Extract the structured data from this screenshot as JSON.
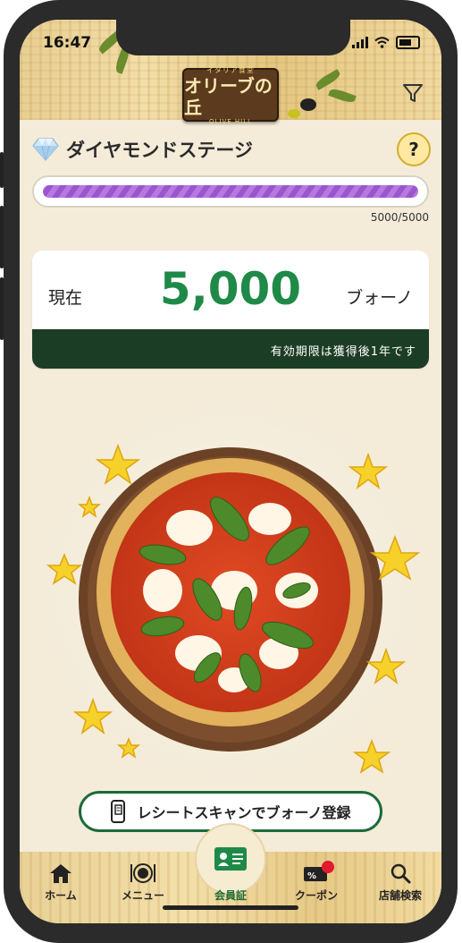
{
  "status": {
    "time": "16:47"
  },
  "logo": {
    "sub": "イタリア食堂",
    "main": "オリーブの丘",
    "en": "OLIVE HILL"
  },
  "stage": {
    "title": "ダイヤモンドステージ",
    "help": "?",
    "progress_text": "5000/5000",
    "progress_fraction": 1.0
  },
  "points": {
    "label": "現在",
    "value": "5,000",
    "unit": "ブォーノ",
    "expiry": "有効期限は獲得後1年です"
  },
  "scan_button": {
    "label": "レシートスキャンでブォーノ登録"
  },
  "nav": {
    "home": "ホーム",
    "menu": "メニュー",
    "member": "会員証",
    "coupon": "クーポン",
    "store": "店舗検索"
  },
  "colors": {
    "accent_green": "#1f8a48",
    "dark_green": "#1c3d25",
    "progress_purple": "#b679df",
    "badge_red": "#e3192f"
  },
  "icons": [
    "filter-icon",
    "diamond-icon",
    "help-icon",
    "receipt-phone-icon",
    "home-icon",
    "menu-plate-icon",
    "member-card-icon",
    "coupon-icon",
    "search-icon"
  ]
}
